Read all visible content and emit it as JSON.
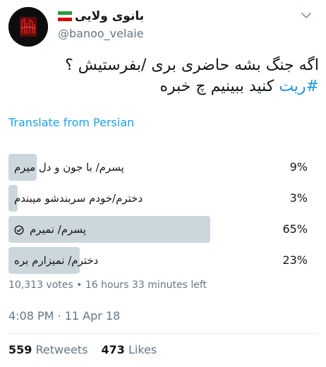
{
  "user": {
    "display_name": "بانوی ولایی",
    "handle": "@banoo_velaie",
    "flag_colors": [
      "#239f40",
      "#ffffff",
      "#da0000"
    ]
  },
  "tweet": {
    "line1": "اگه جنگ بشه حاضری بری /بفرستیش ؟",
    "hashtag": "#ریت",
    "line2_rest": " کنید ببینیم چ خبره"
  },
  "translate_label": "Translate from Persian",
  "poll": {
    "options": [
      {
        "label": "پسرم/ با جون و دل میرم",
        "percent_label": "9%",
        "fraction": 0.09,
        "winner": false
      },
      {
        "label": "دخترم/خودم سربندشو میبندم",
        "percent_label": "3%",
        "fraction": 0.03,
        "winner": false
      },
      {
        "label": "پسرم/ نمیرم",
        "percent_label": "65%",
        "fraction": 0.65,
        "winner": true
      },
      {
        "label": "دخترم/ نمیزارم بره",
        "percent_label": "23%",
        "fraction": 0.23,
        "winner": false
      }
    ],
    "votes": "10,313 votes",
    "separator": "•",
    "time_left": "16 hours 33 minutes left"
  },
  "timestamp": "4:08 PM · 11 Apr 18",
  "stats": {
    "retweets_count": "559",
    "retweets_label": "Retweets",
    "likes_count": "473",
    "likes_label": "Likes"
  },
  "colors": {
    "accent": "#1da1f2",
    "poll_bar": "#ccd6dd",
    "muted": "#657786"
  }
}
